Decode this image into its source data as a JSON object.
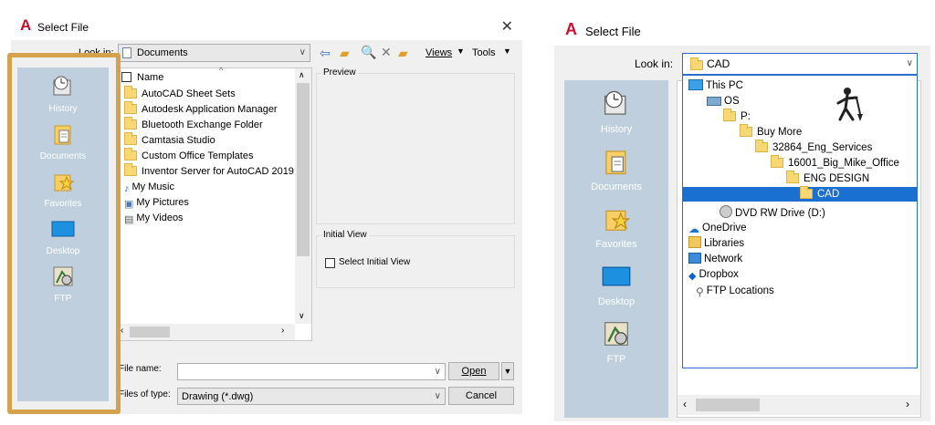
{
  "left_dialog": {
    "title": "Select File",
    "close_glyph": "✕",
    "look_in_label": "Look in:",
    "look_in_value": "Documents",
    "toolbar": {
      "views_label": "Views",
      "tools_label": "Tools"
    },
    "places": [
      {
        "label": "History",
        "icon": "history-icon"
      },
      {
        "label": "Documents",
        "icon": "documents-icon"
      },
      {
        "label": "Favorites",
        "icon": "favorites-icon"
      },
      {
        "label": "Desktop",
        "icon": "desktop-icon"
      },
      {
        "label": "FTP",
        "icon": "ftp-icon"
      }
    ],
    "list_header": "Name",
    "files": [
      {
        "name": "AutoCAD Sheet Sets",
        "icon": "folder-icon"
      },
      {
        "name": "Autodesk Application Manager",
        "icon": "folder-icon"
      },
      {
        "name": "Bluetooth Exchange Folder",
        "icon": "folder-icon"
      },
      {
        "name": "Camtasia Studio",
        "icon": "folder-icon"
      },
      {
        "name": "Custom Office Templates",
        "icon": "folder-icon"
      },
      {
        "name": "Inventor Server for AutoCAD 2019",
        "icon": "folder-icon"
      },
      {
        "name": "My Music",
        "icon": "music-icon"
      },
      {
        "name": "My Pictures",
        "icon": "pictures-icon"
      },
      {
        "name": "My Videos",
        "icon": "videos-icon"
      }
    ],
    "preview_label": "Preview",
    "initial_view_label": "Initial View",
    "select_initial_view_label": "Select Initial View",
    "file_name_label": "File name:",
    "file_name_value": "",
    "files_of_type_label": "Files of type:",
    "files_of_type_value": "Drawing (*.dwg)",
    "open_label": "Open",
    "cancel_label": "Cancel"
  },
  "right_dialog": {
    "title": "Select File",
    "look_in_label": "Look in:",
    "look_in_value": "CAD",
    "places": [
      {
        "label": "History",
        "icon": "history-icon"
      },
      {
        "label": "Documents",
        "icon": "documents-icon"
      },
      {
        "label": "Favorites",
        "icon": "favorites-icon"
      },
      {
        "label": "Desktop",
        "icon": "desktop-icon"
      },
      {
        "label": "FTP",
        "icon": "ftp-icon"
      }
    ],
    "tree": [
      {
        "label": "This PC",
        "icon": "pc-icon",
        "level": 0
      },
      {
        "label": "OS",
        "icon": "drive-icon",
        "level": 1
      },
      {
        "label": "P:",
        "icon": "folder-icon",
        "level": 2
      },
      {
        "label": "Buy More",
        "icon": "folder-icon",
        "level": 3
      },
      {
        "label": "32864_Eng_Services",
        "icon": "folder-icon",
        "level": 4
      },
      {
        "label": "16001_Big_Mike_Office",
        "icon": "folder-icon",
        "level": 5
      },
      {
        "label": "ENG DESIGN",
        "icon": "folder-icon",
        "level": 6
      },
      {
        "label": "CAD",
        "icon": "folder-icon",
        "level": 7,
        "selected": true
      },
      {
        "label": "DVD RW Drive (D:)",
        "icon": "dvd-icon",
        "level": 2
      },
      {
        "label": "OneDrive",
        "icon": "onedrive-icon",
        "level": 0
      },
      {
        "label": "Libraries",
        "icon": "libraries-icon",
        "level": 0
      },
      {
        "label": "Network",
        "icon": "network-icon",
        "level": 0
      },
      {
        "label": "Dropbox",
        "icon": "dropbox-icon",
        "level": 0
      },
      {
        "label": "FTP Locations",
        "icon": "ftp-locations-icon",
        "level": 0
      }
    ]
  },
  "colors": {
    "highlight_frame": "#d4a24c",
    "places_bg": "#bfcfdd",
    "selection": "#1b6fd1"
  }
}
